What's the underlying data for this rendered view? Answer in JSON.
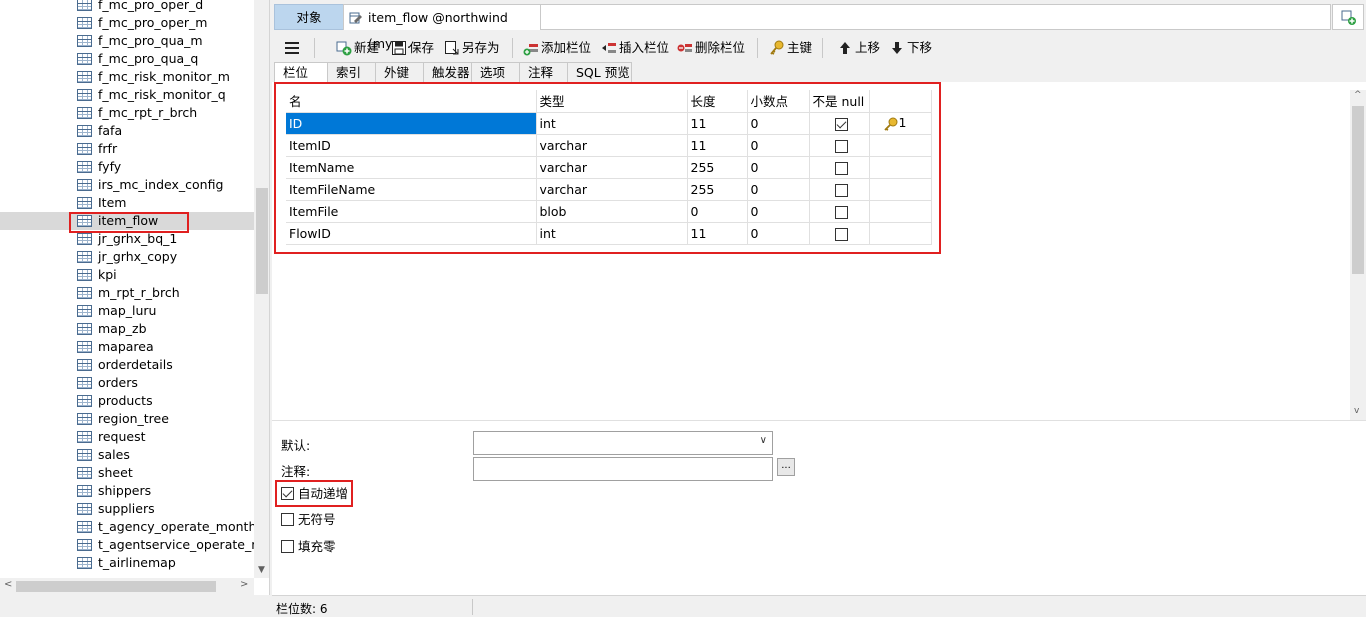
{
  "tree": {
    "items": [
      "f_mc_pro_oper_d",
      "f_mc_pro_oper_m",
      "f_mc_pro_qua_m",
      "f_mc_pro_qua_q",
      "f_mc_risk_monitor_m",
      "f_mc_risk_monitor_q",
      "f_mc_rpt_r_brch",
      "fafa",
      "frfr",
      "fyfy",
      "irs_mc_index_config",
      "Item",
      "item_flow",
      "jr_grhx_bq_1",
      "jr_grhx_copy",
      "kpi",
      "m_rpt_r_brch",
      "map_luru",
      "map_zb",
      "maparea",
      "orderdetails",
      "orders",
      "products",
      "region_tree",
      "request",
      "sales",
      "sheet",
      "shippers",
      "suppliers",
      "t_agency_operate_month",
      "t_agentservice_operate_mc",
      "t_airlinemap"
    ],
    "selected": "item_flow"
  },
  "tabs": {
    "objects": "对象",
    "item_flow": "item_flow @northwind (mys..."
  },
  "toolbar": {
    "new": "新建",
    "save": "保存",
    "save_as": "另存为",
    "add_field": "添加栏位",
    "insert_field": "插入栏位",
    "delete_field": "删除栏位",
    "primary_key": "主键",
    "move_up": "上移",
    "move_down": "下移"
  },
  "subtabs": [
    "栏位",
    "索引",
    "外键",
    "触发器",
    "选项",
    "注释",
    "SQL 预览"
  ],
  "grid": {
    "headers": [
      "名",
      "类型",
      "长度",
      "小数点",
      "不是 null",
      ""
    ],
    "rows": [
      {
        "name": "ID",
        "type": "int",
        "length": "11",
        "decimals": "0",
        "not_null": true,
        "key": "1"
      },
      {
        "name": "ItemID",
        "type": "varchar",
        "length": "11",
        "decimals": "0",
        "not_null": false,
        "key": ""
      },
      {
        "name": "ItemName",
        "type": "varchar",
        "length": "255",
        "decimals": "0",
        "not_null": false,
        "key": ""
      },
      {
        "name": "ItemFileName",
        "type": "varchar",
        "length": "255",
        "decimals": "0",
        "not_null": false,
        "key": ""
      },
      {
        "name": "ItemFile",
        "type": "blob",
        "length": "0",
        "decimals": "0",
        "not_null": false,
        "key": ""
      },
      {
        "name": "FlowID",
        "type": "int",
        "length": "11",
        "decimals": "0",
        "not_null": false,
        "key": ""
      }
    ]
  },
  "props": {
    "default_label": "默认:",
    "comment_label": "注释:",
    "comment_btn": "...",
    "auto_increment": "自动递增",
    "unsigned": "无符号",
    "zerofill": "填充零",
    "auto_increment_checked": true,
    "unsigned_checked": false,
    "zerofill_checked": false
  },
  "status": {
    "field_count": "栏位数: 6"
  }
}
